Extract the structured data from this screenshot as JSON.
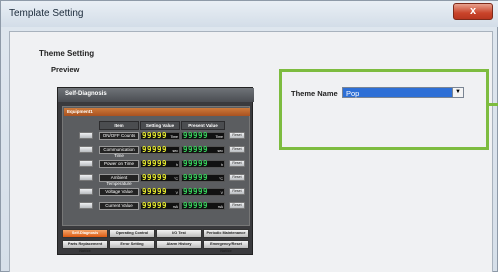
{
  "window": {
    "title": "Template Setting",
    "close_label": "x"
  },
  "page": {
    "heading": "Theme Setting",
    "preview_label": "Preview"
  },
  "preview": {
    "title": "Self-Diagnosis",
    "panel_label": "Equipment1",
    "headers": {
      "item": "Item",
      "setting": "Setting Value",
      "present": "Present Value"
    },
    "rows": [
      {
        "item": "ON/OFF Counts",
        "setting": "99999",
        "setting_unit": "Time",
        "present": "99999",
        "present_unit": "Time",
        "reset": "Reset"
      },
      {
        "item": "Communication Time",
        "setting": "99999",
        "setting_unit": "sec",
        "present": "99999",
        "present_unit": "sec",
        "reset": "Reset"
      },
      {
        "item": "Power on Time",
        "setting": "99999",
        "setting_unit": "h",
        "present": "99999",
        "present_unit": "h",
        "reset": "Reset"
      },
      {
        "item": "Ambient Temperature",
        "setting": "99999",
        "setting_unit": "°C",
        "present": "99999",
        "present_unit": "°C",
        "reset": "Reset"
      },
      {
        "item": "Voltage Value",
        "setting": "99999",
        "setting_unit": "V",
        "present": "99999",
        "present_unit": "V",
        "reset": "Reset"
      },
      {
        "item": "Current Value",
        "setting": "99999",
        "setting_unit": "mA",
        "present": "99999",
        "present_unit": "mA",
        "reset": "Reset"
      }
    ],
    "tabs_row1": [
      "Self-Diagnosis",
      "Operating Control",
      "I/O Test",
      "Periodic Maintenance"
    ],
    "tabs_row2": [
      "Parts Replacement Notice",
      "Error Setting",
      "Alarm History",
      "Emergency/Reset Notice"
    ],
    "active_tab": 0
  },
  "theme": {
    "label": "Theme Name",
    "selected": "Pop",
    "arrow_icon": "▼"
  },
  "colors": {
    "highlight": "#7dbc3f",
    "accent": "#dd5b14",
    "select_bg": "#2d6fd6",
    "segment_yellow": "#e6ea2e",
    "segment_green": "#36d35c"
  }
}
